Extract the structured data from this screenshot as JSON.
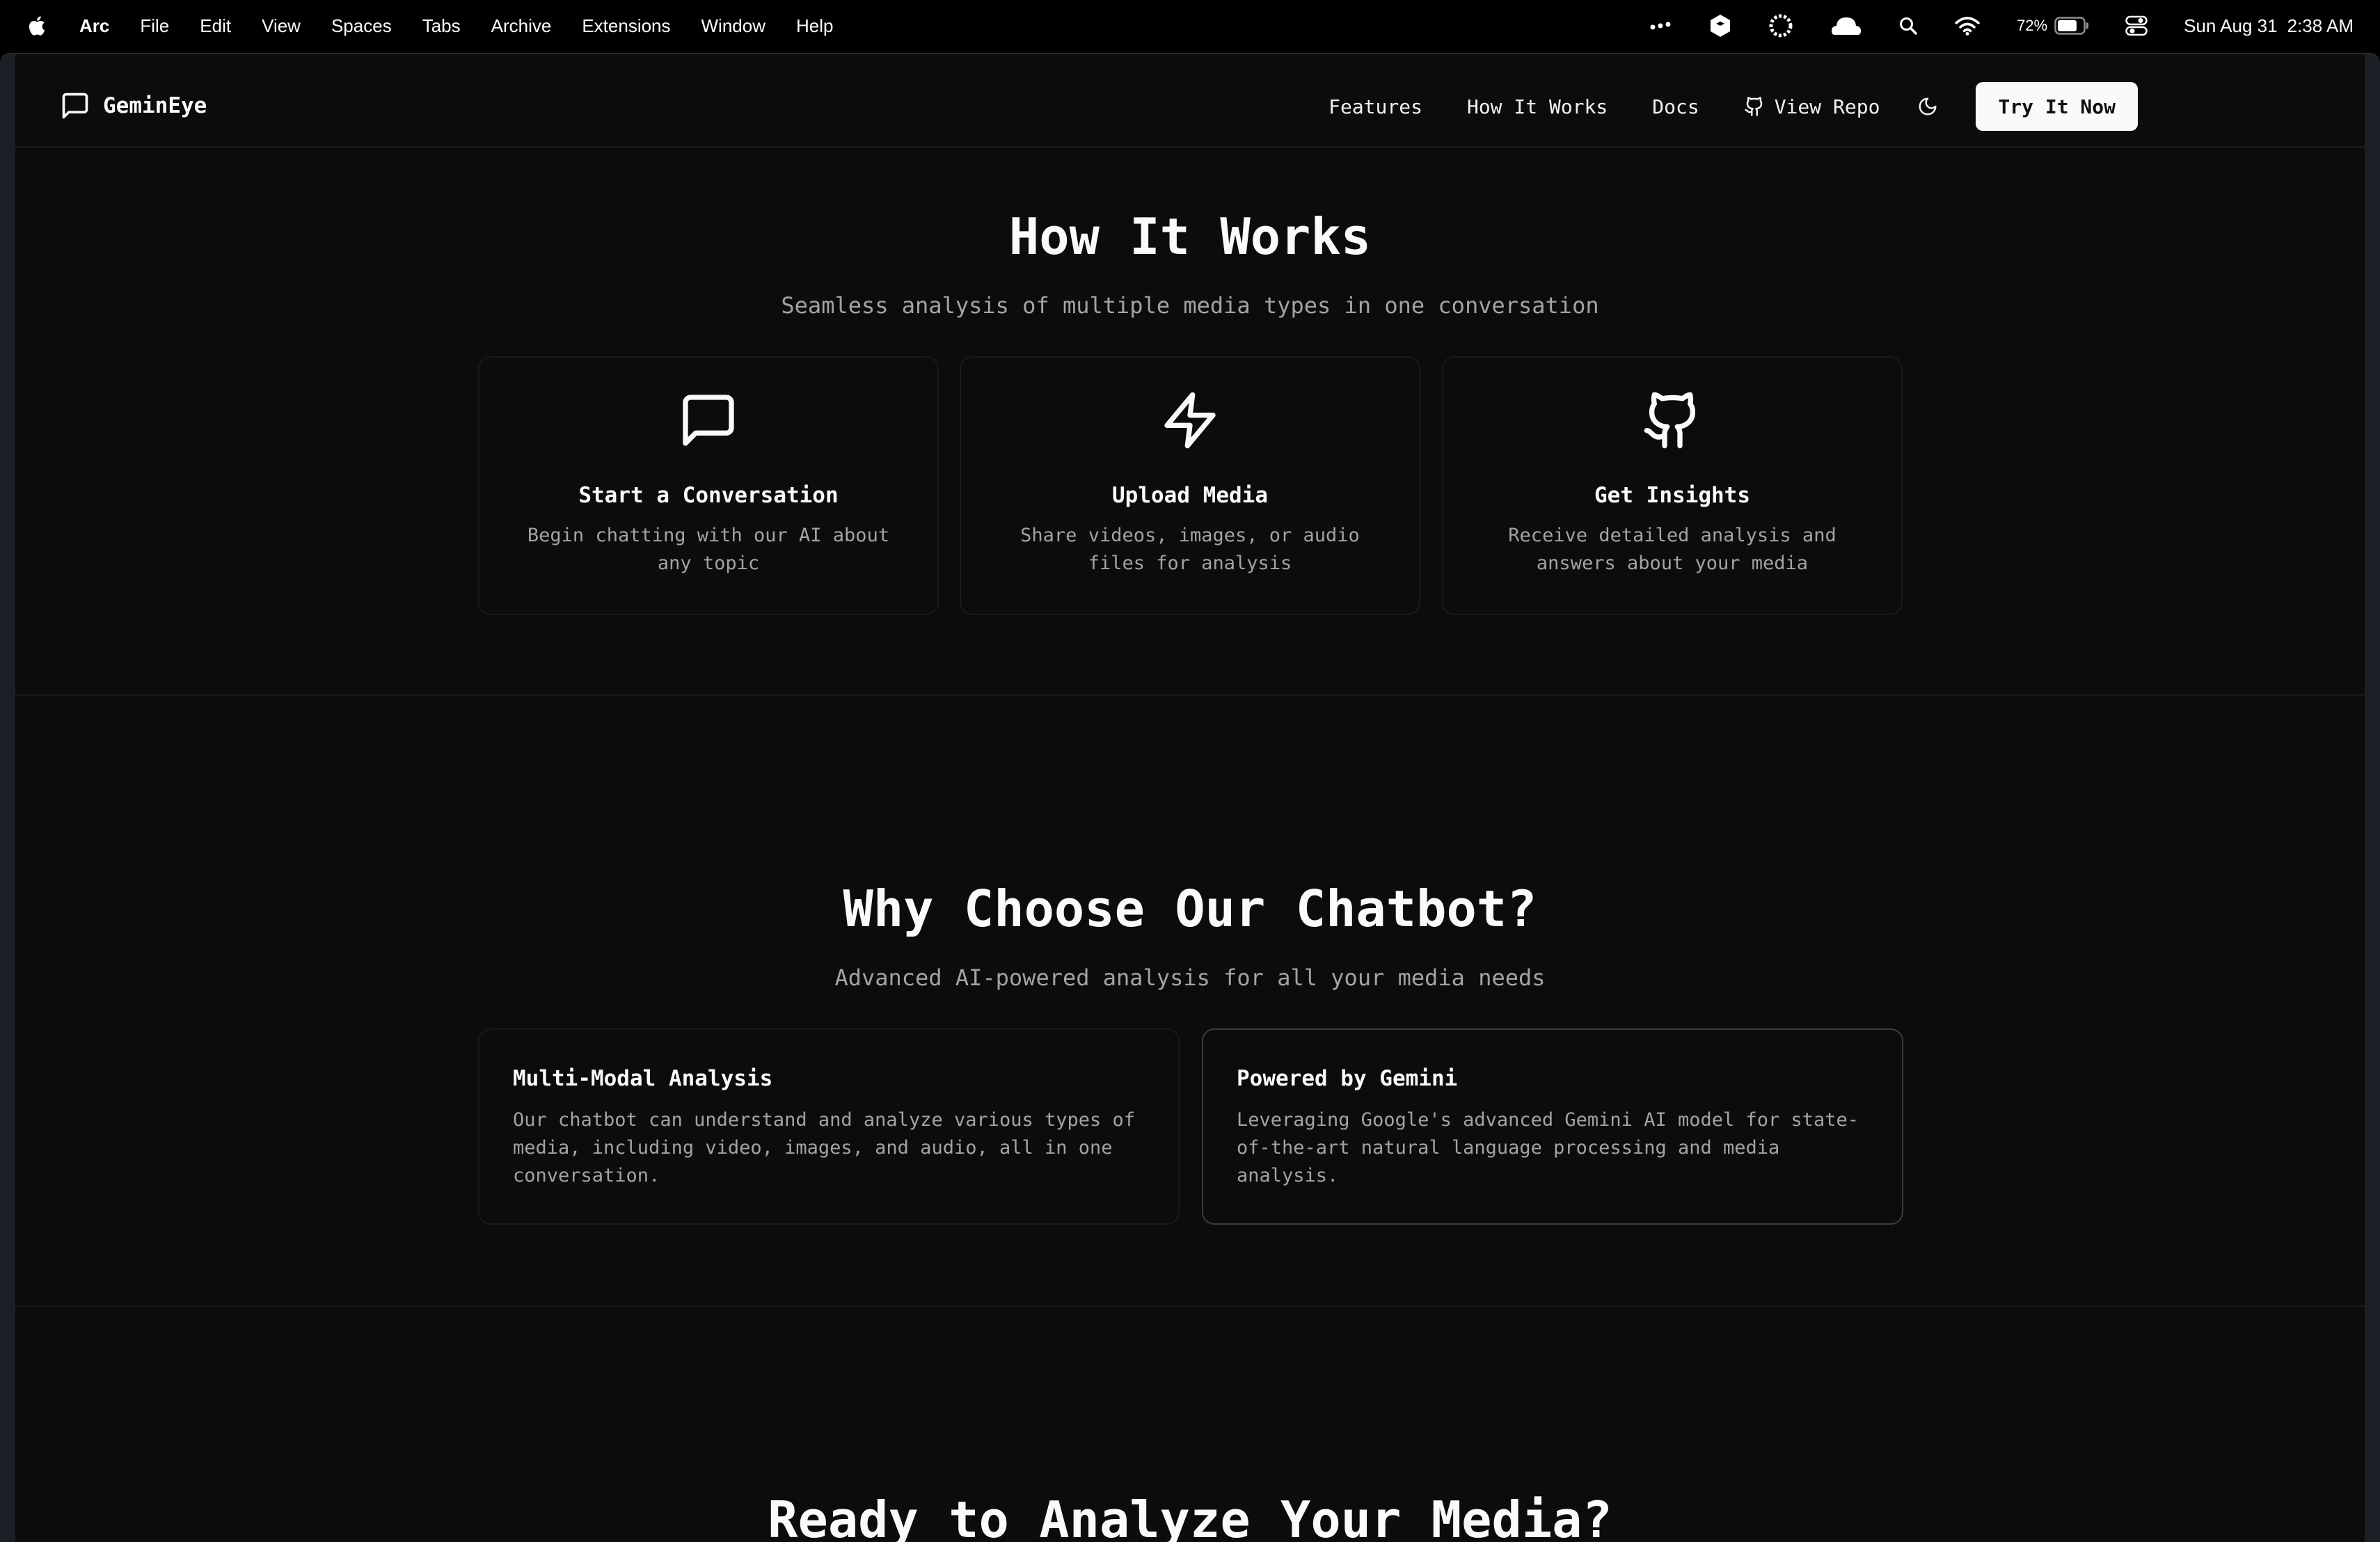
{
  "menubar": {
    "app": "Arc",
    "items": [
      "File",
      "Edit",
      "View",
      "Spaces",
      "Tabs",
      "Archive",
      "Extensions",
      "Window",
      "Help"
    ],
    "battery": "72%",
    "date": "Sun Aug 31",
    "time": "2:38 AM"
  },
  "site": {
    "logo": "GeminEye",
    "nav": {
      "features": "Features",
      "how": "How It Works",
      "docs": "Docs",
      "repo": "View Repo",
      "cta": "Try It Now"
    }
  },
  "how": {
    "title": "How It Works",
    "subtitle": "Seamless analysis of multiple media types in one conversation",
    "steps": [
      {
        "icon": "message-square-icon",
        "title": "Start a Conversation",
        "desc": "Begin chatting with our AI about any topic"
      },
      {
        "icon": "zap-icon",
        "title": "Upload Media",
        "desc": "Share videos, images, or audio files for analysis"
      },
      {
        "icon": "github-icon",
        "title": "Get Insights",
        "desc": "Receive detailed analysis and answers about your media"
      }
    ]
  },
  "why": {
    "title": "Why Choose Our Chatbot?",
    "subtitle": "Advanced AI-powered analysis for all your media needs",
    "features": [
      {
        "title": "Multi-Modal Analysis",
        "desc": "Our chatbot can understand and analyze various types of media, including video, images, and audio, all in one conversation."
      },
      {
        "title": "Powered by Gemini",
        "desc": "Leveraging Google's advanced Gemini AI model for state-of-the-art natural language processing and media analysis."
      }
    ]
  },
  "cta_section": {
    "title": "Ready to Analyze Your Media?"
  }
}
